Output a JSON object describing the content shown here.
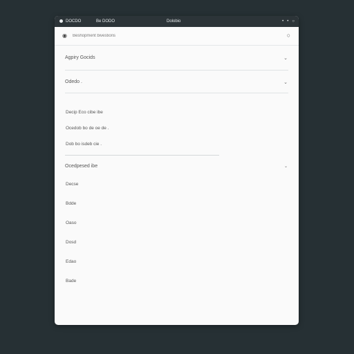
{
  "titlebar": {
    "app_name": "DOCDO",
    "menu": "Be DODO",
    "title": "Dolobio",
    "controls": [
      "•",
      "•",
      "○"
    ]
  },
  "search": {
    "placeholder": "Beshopment bivestions"
  },
  "accordion": {
    "section1_label": "Agpiry Gocids",
    "section2_label": "Odedo .",
    "sub_items": [
      "Decip Eco cibe ibe",
      "Ocedob bo de oe de .",
      "Dob bo isdeb cie ."
    ],
    "section3_label": "Ocedpesed ibe",
    "list_items": [
      "Decse",
      "Bdde",
      "Oaso",
      "Dosd",
      "Edao",
      "Bade"
    ]
  },
  "icons": {
    "search_left": "location-pin-icon",
    "search_right": "search-icon",
    "chevron": "chevron-down-icon"
  },
  "colors": {
    "background": "#263034",
    "titlebar": "#2c3438",
    "panel": "#fafafa"
  }
}
